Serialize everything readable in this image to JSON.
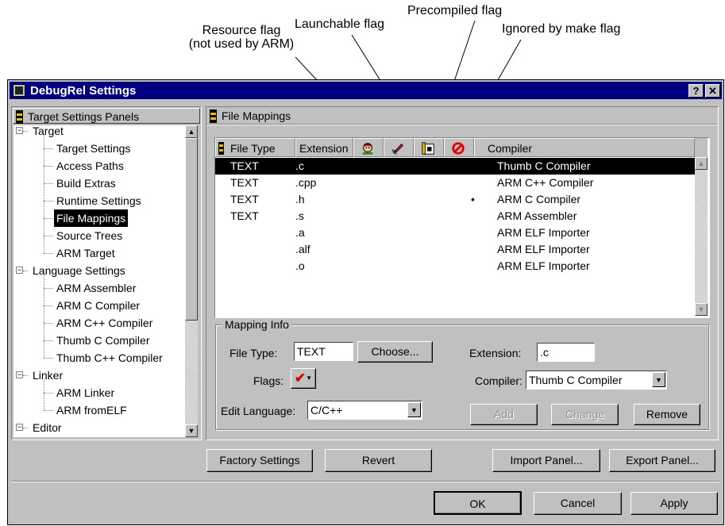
{
  "callouts": {
    "resource_line1": "Resource flag",
    "resource_line2": "(not used by ARM)",
    "launchable": "Launchable flag",
    "precompiled": "Precompiled flag",
    "ignored": "Ignored by make flag"
  },
  "window": {
    "title": "DebugRel Settings",
    "help_button": "?",
    "close_button": "✕"
  },
  "sidebar": {
    "header": "Target Settings Panels",
    "items": [
      {
        "label": "Target",
        "group": true,
        "expander": "−"
      },
      {
        "label": "Target Settings"
      },
      {
        "label": "Access Paths"
      },
      {
        "label": "Build Extras"
      },
      {
        "label": "Runtime Settings"
      },
      {
        "label": "File Mappings",
        "selected": true
      },
      {
        "label": "Source Trees"
      },
      {
        "label": "ARM Target"
      },
      {
        "label": "Language Settings",
        "group": true,
        "expander": "−"
      },
      {
        "label": "ARM Assembler"
      },
      {
        "label": "ARM C Compiler"
      },
      {
        "label": "ARM C++ Compiler"
      },
      {
        "label": "Thumb C Compiler"
      },
      {
        "label": "Thumb C++ Compiler"
      },
      {
        "label": "Linker",
        "group": true,
        "expander": "−"
      },
      {
        "label": "ARM Linker"
      },
      {
        "label": "ARM fromELF"
      },
      {
        "label": "Editor",
        "group": true,
        "expander": "−"
      }
    ]
  },
  "main": {
    "header": "File Mappings",
    "columns": {
      "file_type": "File Type",
      "extension": "Extension",
      "compiler": "Compiler"
    },
    "rows": [
      {
        "type": "TEXT",
        "ext": ".c",
        "flag": "",
        "compiler": "Thumb C Compiler",
        "selected": true
      },
      {
        "type": "TEXT",
        "ext": ".cpp",
        "flag": "",
        "compiler": "ARM C++ Compiler"
      },
      {
        "type": "TEXT",
        "ext": ".h",
        "flag": "•",
        "compiler": "ARM C Compiler"
      },
      {
        "type": "TEXT",
        "ext": ".s",
        "flag": "",
        "compiler": "ARM Assembler"
      },
      {
        "type": "",
        "ext": ".a",
        "flag": "",
        "compiler": "ARM ELF Importer"
      },
      {
        "type": "",
        "ext": ".alf",
        "flag": "",
        "compiler": "ARM ELF Importer"
      },
      {
        "type": "",
        "ext": ".o",
        "flag": "",
        "compiler": "ARM ELF Importer"
      }
    ]
  },
  "mapping_info": {
    "title": "Mapping Info",
    "file_type_label": "File Type:",
    "file_type_value": "TEXT",
    "choose_button": "Choose...",
    "extension_label": "Extension:",
    "extension_value": ".c",
    "flags_label": "Flags:",
    "flags_glyph": "✔",
    "compiler_label": "Compiler:",
    "compiler_value": "Thumb C Compiler",
    "edit_language_label": "Edit Language:",
    "edit_language_value": "C/C++",
    "add_button": "Add",
    "change_button": "Change",
    "remove_button": "Remove"
  },
  "panel_buttons": {
    "factory": "Factory Settings",
    "revert": "Revert",
    "import": "Import Panel...",
    "export": "Export Panel..."
  },
  "dialog_buttons": {
    "ok": "OK",
    "cancel": "Cancel",
    "apply": "Apply"
  },
  "colors": {
    "title_bar": "#000080",
    "face": "#c0c0c0",
    "selection": "#000000",
    "flag_check": "#dd0000",
    "ignored_icon": "#e00000"
  },
  "icons": {
    "resource": "resource-flag-icon",
    "launchable": "rocket-icon",
    "precompiled": "precompiled-icon",
    "ignored": "no-entry-icon"
  }
}
